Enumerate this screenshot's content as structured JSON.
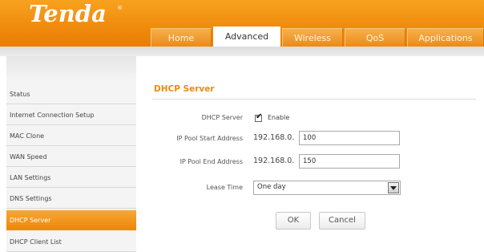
{
  "brand": {
    "logo": "Tenda",
    "registered": "®"
  },
  "tabs": [
    {
      "label": "Home",
      "active": false
    },
    {
      "label": "Advanced",
      "active": true
    },
    {
      "label": "Wireless",
      "active": false
    },
    {
      "label": "QoS",
      "active": false
    },
    {
      "label": "Applications",
      "active": false
    }
  ],
  "sidebar": {
    "items": [
      {
        "label": "Status",
        "active": false
      },
      {
        "label": "Internet Connection Setup",
        "active": false
      },
      {
        "label": "MAC Clone",
        "active": false
      },
      {
        "label": "WAN Speed",
        "active": false
      },
      {
        "label": "LAN Settings",
        "active": false
      },
      {
        "label": "DNS Settings",
        "active": false
      },
      {
        "label": "DHCP Server",
        "active": true
      },
      {
        "label": "DHCP Client List",
        "active": false
      }
    ]
  },
  "form": {
    "title": "DHCP Server",
    "dhcp_server": {
      "label": "DHCP Server",
      "checked": true,
      "option_label": "Enable"
    },
    "start_ip": {
      "label": "IP Pool Start Address",
      "prefix": "192.168.0.",
      "value": "100"
    },
    "end_ip": {
      "label": "IP Pool End Address",
      "prefix": "192.168.0.",
      "value": "150"
    },
    "lease_time": {
      "label": "Lease Time",
      "value": "One day"
    },
    "ok_label": "OK",
    "cancel_label": "Cancel"
  },
  "colors": {
    "brand_orange": "#f08a0c",
    "title_orange": "#ef8a12",
    "active_item": "#ee8709"
  }
}
